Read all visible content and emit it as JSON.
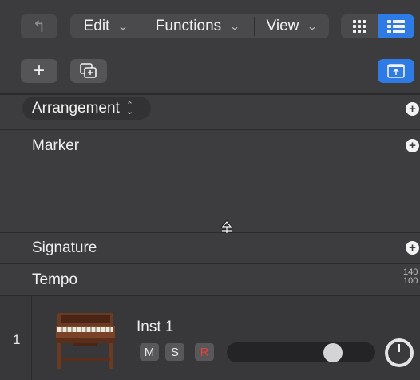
{
  "toolbar": {
    "back_symbol": "↰",
    "menus": [
      {
        "label": "Edit"
      },
      {
        "label": "Functions"
      },
      {
        "label": "View"
      }
    ],
    "chevron_symbol": "⌄",
    "view_toggle": [
      {
        "icon": "grid-view-icon",
        "active": false
      },
      {
        "icon": "list-view-icon",
        "active": true
      }
    ]
  },
  "toolbar2": {
    "add_symbol": "+"
  },
  "global_tracks": {
    "arrangement": {
      "label": "Arrangement"
    },
    "marker": {
      "label": "Marker"
    },
    "signature": {
      "label": "Signature"
    },
    "tempo": {
      "label": "Tempo",
      "values": [
        "140",
        "100"
      ]
    }
  },
  "track": {
    "number": "1",
    "name": "Inst 1",
    "mute_label": "M",
    "solo_label": "S",
    "record_label": "R",
    "volume_level": 0.74
  },
  "colors": {
    "accent": "#2f7be6",
    "record": "#e0433a",
    "background": "#2b2b2d"
  }
}
